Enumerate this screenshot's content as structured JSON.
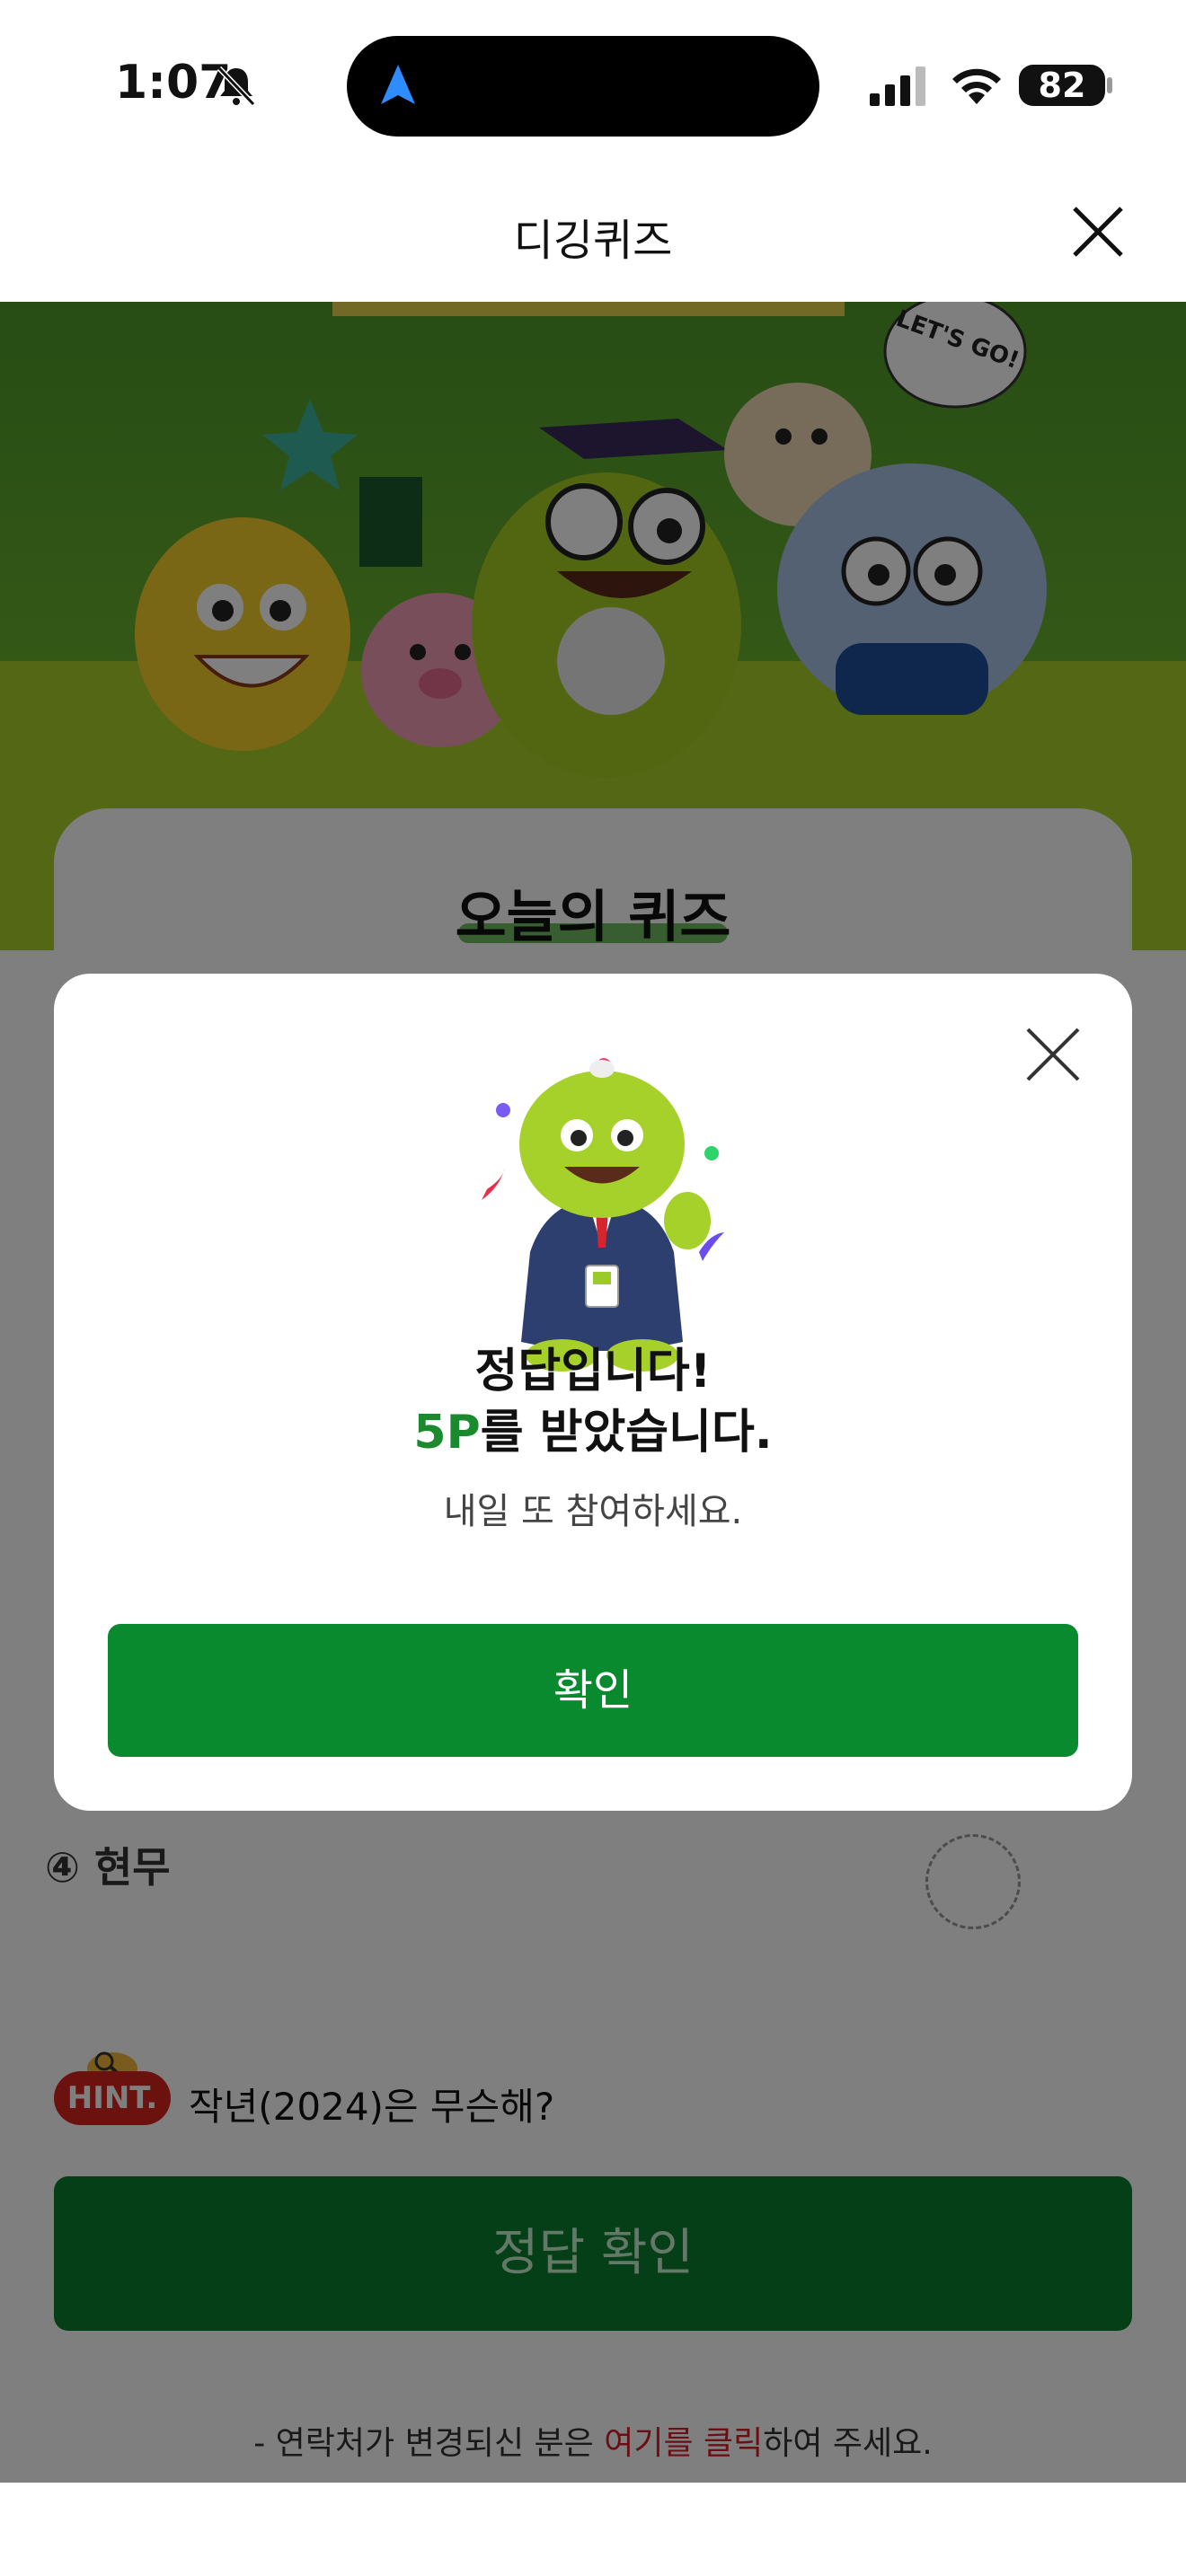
{
  "status_bar": {
    "time": "1:07",
    "battery": "82",
    "icons": [
      "bell-off-icon",
      "navigation-arrow-icon",
      "cellular-signal-icon",
      "wifi-icon",
      "battery-icon"
    ]
  },
  "header": {
    "title": "디깅퀴즈",
    "close_icon": "close-icon"
  },
  "hero": {
    "speech_bubble": "LET'S GO!"
  },
  "quiz": {
    "title": "오늘의 퀴즈",
    "options": [
      {
        "label": "④ 현무"
      }
    ]
  },
  "hint": {
    "badge": "HINT.",
    "text": "작년(2024)은 무슨해?"
  },
  "submit": {
    "label": "정답 확인"
  },
  "footer": {
    "prefix": "- 연락처가 변경되신 분은 ",
    "link": "여기를 클릭",
    "suffix": "하여 주세요."
  },
  "modal": {
    "close_icon": "close-icon",
    "title": "정답입니다!",
    "points": "5P",
    "reward_suffix": "를 받았습니다.",
    "subtitle": "내일 또 참여하세요.",
    "confirm_label": "확인"
  },
  "colors": {
    "brand_green": "#0a8a2e",
    "hint_red": "#d9241c",
    "link_red": "#d81f2a"
  }
}
